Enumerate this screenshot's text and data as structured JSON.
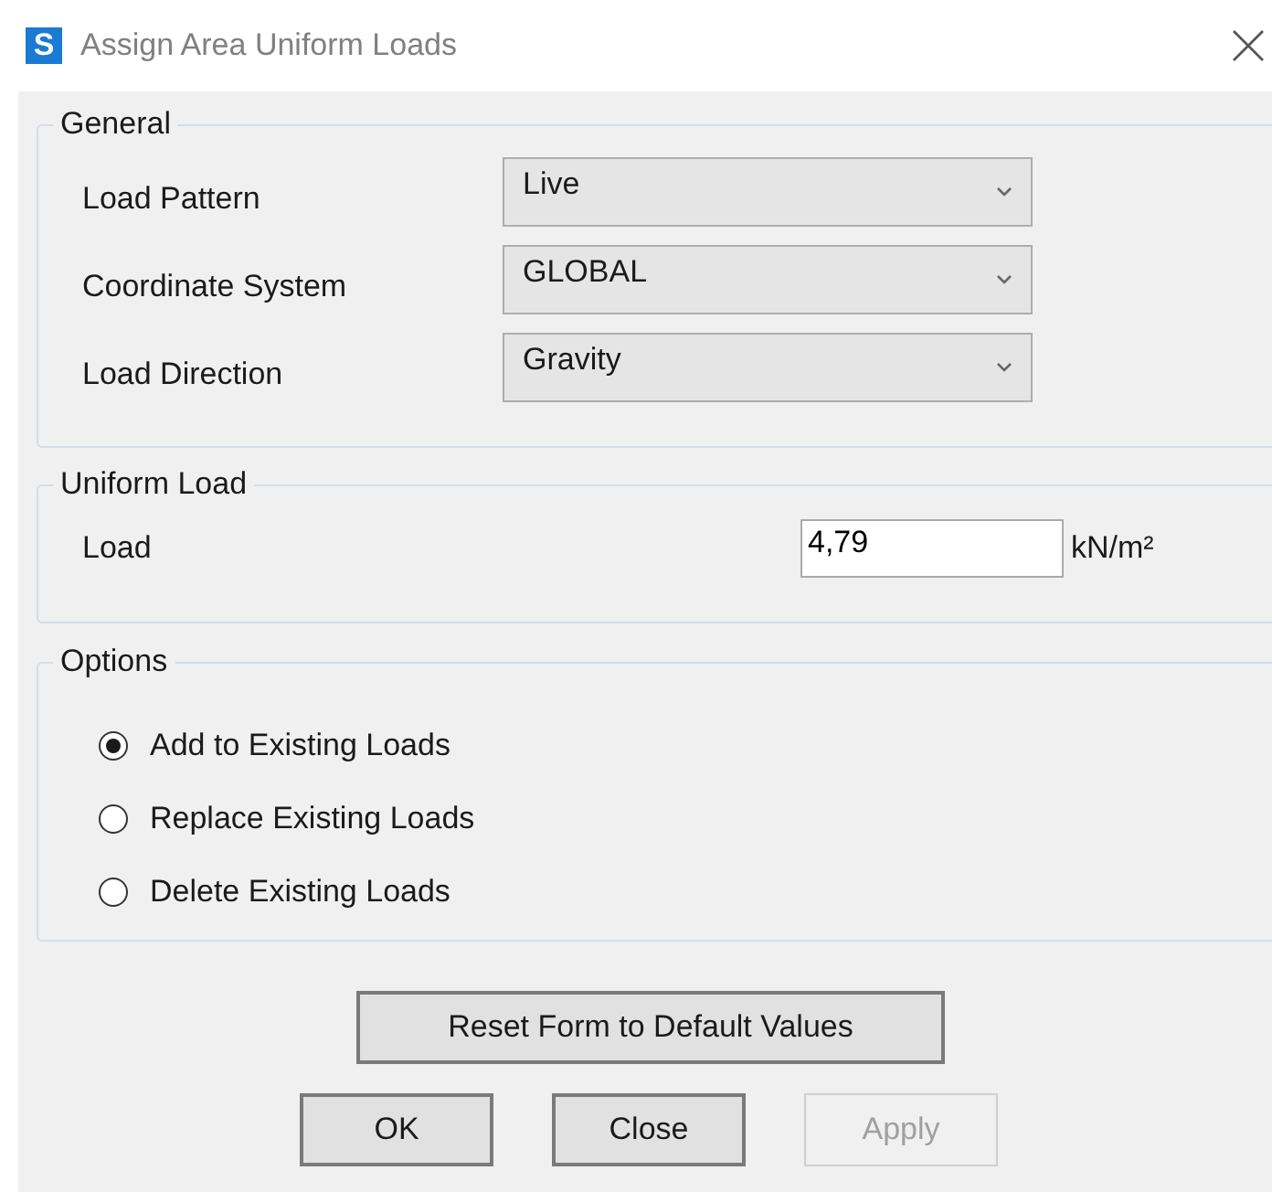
{
  "window": {
    "app_icon": "S",
    "title": "Assign Area Uniform Loads"
  },
  "general": {
    "title": "General",
    "fields": [
      {
        "label": "Load Pattern",
        "value": "Live"
      },
      {
        "label": "Coordinate System",
        "value": "GLOBAL"
      },
      {
        "label": "Load Direction",
        "value": "Gravity"
      }
    ]
  },
  "uniform_load": {
    "title": "Uniform Load",
    "label": "Load",
    "value": "4,79",
    "unit": "kN/m²"
  },
  "options": {
    "title": "Options",
    "items": [
      {
        "label": "Add to Existing Loads",
        "selected": true
      },
      {
        "label": "Replace Existing Loads",
        "selected": false
      },
      {
        "label": "Delete Existing Loads",
        "selected": false
      }
    ]
  },
  "reset_button": {
    "label": "Reset Form to Default Values",
    "disabled": false
  },
  "buttons": [
    {
      "label": "OK",
      "disabled": false
    },
    {
      "label": "Close",
      "disabled": false
    },
    {
      "label": "Apply",
      "disabled": true
    }
  ]
}
